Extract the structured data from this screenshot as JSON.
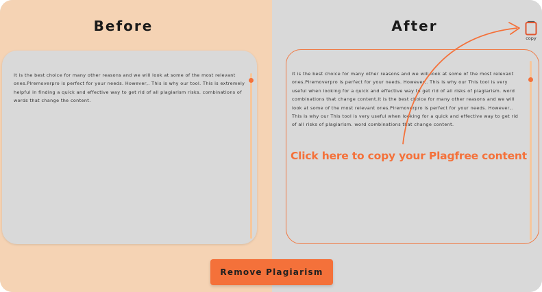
{
  "panels": {
    "before": {
      "title": "Before",
      "text": "It is the best choice for many other reasons and we will look at some of the most relevant ones.Plremoverpro is perfect for your needs. However,. This is why our tool. This is extremely helpful in finding a quick and effective way to get rid of all plagiarism risks. combinations of words that change the content."
    },
    "after": {
      "title": "After",
      "text": "It is the best choice for many other reasons and we will look at some of the most relevant ones.Plremoverpro is perfect for your needs. However,. This is why our This tool is very useful when looking for a quick and effective way to get rid of all risks of plagiarism. word combinations that change content.It is the best choice for many other reasons and we will look at some of the most relevant ones.Plremoverpro is perfect for your needs. However,. This is why our This tool is very useful when looking for a quick and effective way to get rid of all risks of plagiarism. word combinations that change content."
    }
  },
  "copy": {
    "label": "copy",
    "icon": "clipboard-icon"
  },
  "callout": "Click here to copy your Plagfree content",
  "action_button": {
    "label": "Remove Plagiarism"
  },
  "colors": {
    "accent": "#f4713a",
    "left_background": "#f5d3b4",
    "right_background": "#d9d9d9",
    "card_background": "#d9d9d9",
    "scrollbar_track": "#f6c79c"
  }
}
